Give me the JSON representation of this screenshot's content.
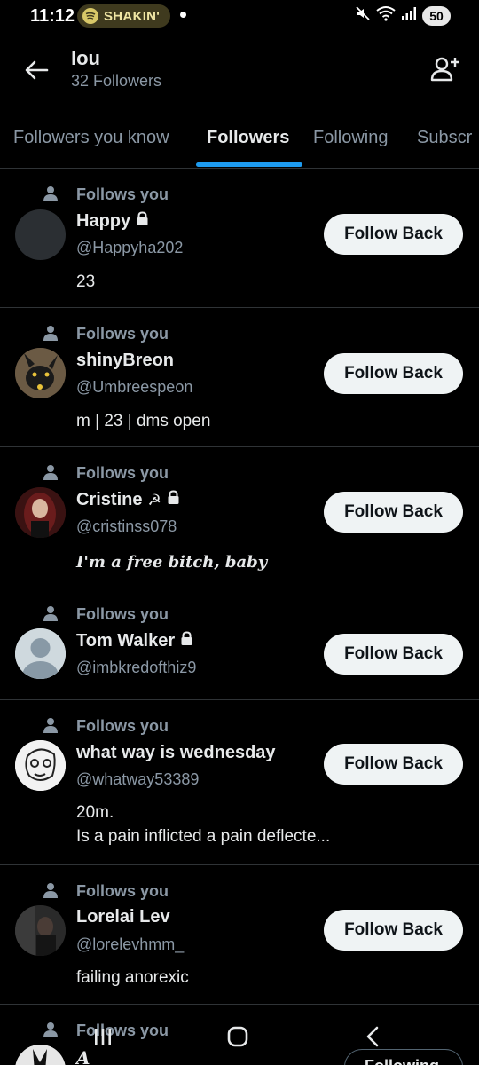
{
  "status_bar": {
    "time": "11:12",
    "media_chip": "SHAKIN'",
    "battery": "50"
  },
  "header": {
    "name": "lou",
    "subtitle": "32 Followers"
  },
  "tabs": [
    {
      "label": "Followers you know",
      "active": false
    },
    {
      "label": "Followers",
      "active": true
    },
    {
      "label": "Following",
      "active": false
    },
    {
      "label": "Subscr",
      "active": false
    }
  ],
  "follows_you_label": "Follows you",
  "follow_back_label": "Follow Back",
  "users": [
    {
      "name": "Happy",
      "handle": "@Happyha202",
      "bio": "23",
      "locked": true,
      "extra_icon": ""
    },
    {
      "name": "shinyBreon",
      "handle": "@Umbreespeon",
      "bio": "m | 23 | dms open",
      "locked": false,
      "extra_icon": ""
    },
    {
      "name": "Cristine",
      "handle": "@cristinss078",
      "bio": "I'm a free bitch, baby",
      "locked": true,
      "extra_icon": "☭"
    },
    {
      "name": "Tom Walker",
      "handle": "@imbkredofthiz9",
      "bio": "",
      "locked": true,
      "extra_icon": ""
    },
    {
      "name": "what way is wednesday",
      "handle": "@whatway53389",
      "bio": "20m.\n Is a pain inflicted a pain deflecte...",
      "locked": false,
      "extra_icon": ""
    },
    {
      "name": "Lorelai Lev",
      "handle": "@lorelevhmm_",
      "bio": "failing anorexic",
      "locked": false,
      "extra_icon": ""
    }
  ],
  "partial_row": {
    "follows_you": "Follows you",
    "name_glyph": "A",
    "button": "Following"
  },
  "colors": {
    "background": "#000000",
    "accent": "#1d9bf0",
    "secondary_text": "#8b98a5",
    "divider": "#2f3336",
    "button_bg": "#eff3f4"
  }
}
